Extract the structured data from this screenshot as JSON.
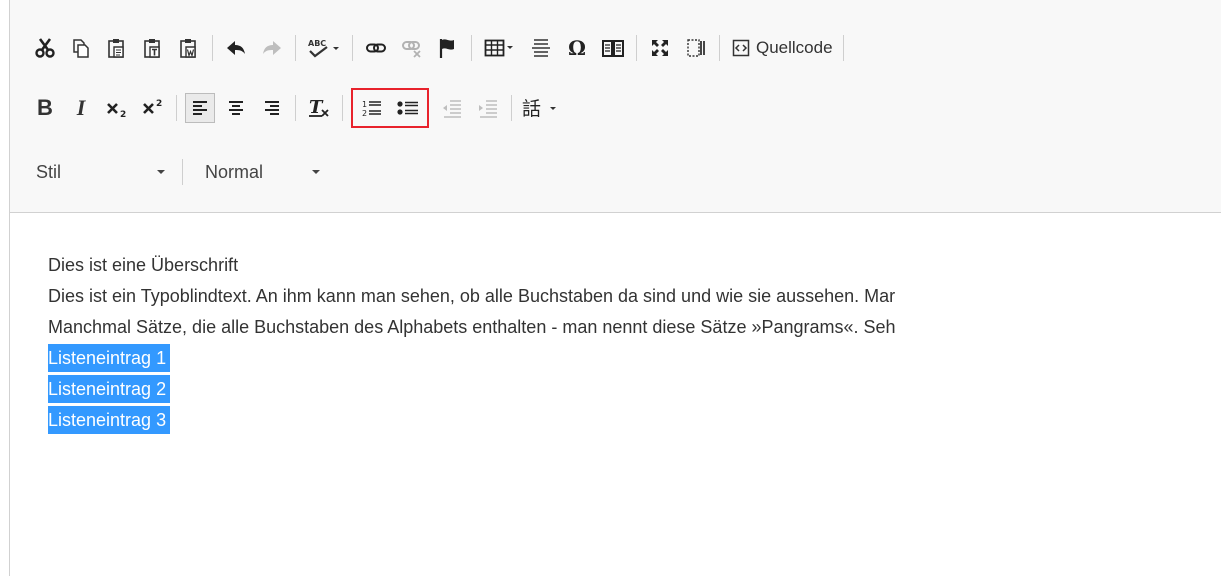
{
  "toolbar": {
    "source_label": "Quellcode",
    "style_combo": {
      "value": "Stil"
    },
    "format_combo": {
      "value": "Normal"
    },
    "highlight_color": "#e8222c",
    "icons": [
      "cut-icon",
      "copy-icon",
      "paste-icon",
      "paste-text-icon",
      "paste-from-word-icon",
      "undo-icon",
      "redo-icon",
      "spellcheck-icon",
      "link-icon",
      "unlink-icon",
      "anchor-icon",
      "table-icon",
      "horizontal-rule-icon",
      "special-char-icon",
      "template-icon",
      "maximize-icon",
      "show-blocks-icon",
      "source-icon",
      "bold-icon",
      "italic-icon",
      "subscript-icon",
      "superscript-icon",
      "align-left-icon",
      "align-center-icon",
      "align-right-icon",
      "remove-format-icon",
      "numbered-list-icon",
      "bulleted-list-icon",
      "outdent-icon",
      "indent-icon",
      "language-icon"
    ]
  },
  "editor": {
    "heading": "Dies ist eine Überschrift",
    "paragraph_line1": "Dies ist ein Typoblindtext. An ihm kann man sehen, ob alle Buchstaben da sind und wie sie aussehen. Mar",
    "paragraph_line2": "Manchmal Sätze, die alle Buchstaben des Alphabets enthalten - man nennt diese Sätze »Pangrams«. Seh",
    "list_items": [
      "Listeneintrag 1",
      "Listeneintrag 2",
      "Listeneintrag 3"
    ],
    "selection_color": "#3399ff"
  }
}
